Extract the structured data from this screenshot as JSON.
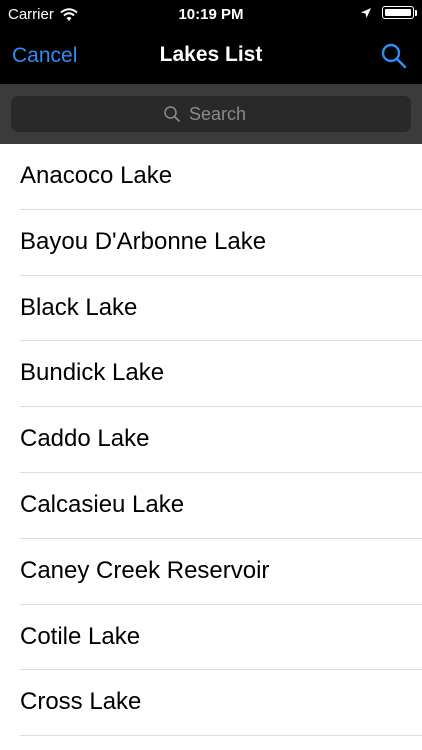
{
  "status_bar": {
    "carrier": "Carrier",
    "time": "10:19 PM",
    "icons": [
      "wifi-icon",
      "location-arrow-icon",
      "battery-icon"
    ],
    "battery_level": 1.0
  },
  "nav": {
    "cancel_label": "Cancel",
    "title": "Lakes List",
    "search_icon": "search-icon"
  },
  "search": {
    "placeholder": "Search",
    "value": ""
  },
  "lakes": [
    {
      "label": "Anacoco Lake"
    },
    {
      "label": "Bayou D'Arbonne Lake"
    },
    {
      "label": "Black Lake"
    },
    {
      "label": "Bundick Lake"
    },
    {
      "label": "Caddo Lake"
    },
    {
      "label": "Calcasieu Lake"
    },
    {
      "label": "Caney Creek Reservoir"
    },
    {
      "label": "Cotile Lake"
    },
    {
      "label": "Cross Lake"
    }
  ],
  "colors": {
    "accent": "#2f8cf5",
    "nav_background": "#000000",
    "search_area_background": "#3b3b3b",
    "search_field_background": "#292929",
    "divider": "#dcdcdc"
  }
}
